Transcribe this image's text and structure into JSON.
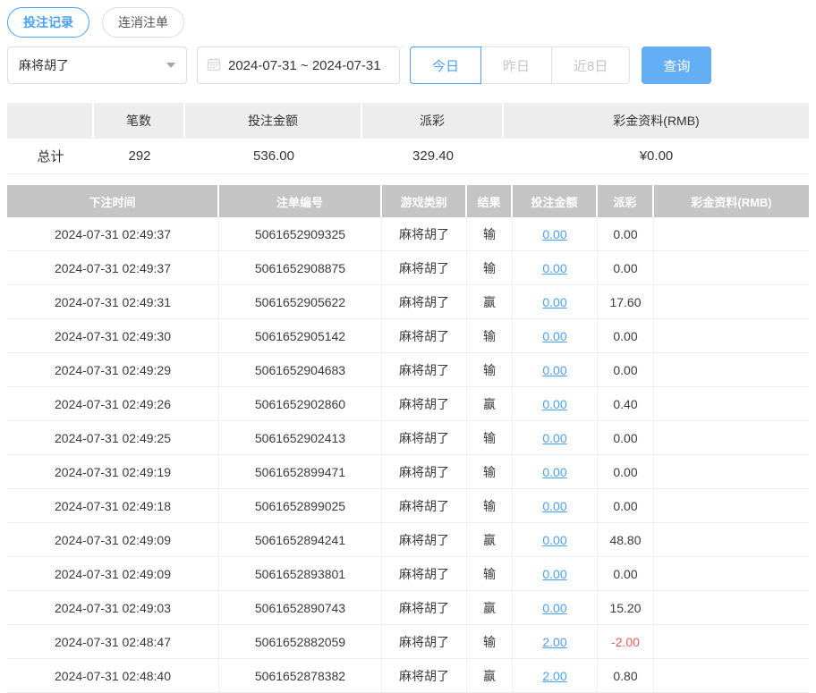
{
  "tabs": [
    {
      "label": "投注记录",
      "active": true
    },
    {
      "label": "连消注单",
      "active": false
    }
  ],
  "filters": {
    "game_select": "麻将胡了",
    "date_range": "2024-07-31 ~ 2024-07-31",
    "quick_buttons": [
      {
        "label": "今日",
        "active": true
      },
      {
        "label": "昨日",
        "active": false
      },
      {
        "label": "近8日",
        "active": false
      }
    ],
    "query_label": "查询"
  },
  "summary": {
    "headers": [
      "",
      "笔数",
      "投注金额",
      "派彩",
      "彩金资料(RMB)"
    ],
    "row": {
      "label": "总计",
      "count": "292",
      "bet_amount": "536.00",
      "payout": "329.40",
      "bonus": "¥0.00"
    }
  },
  "table": {
    "headers": [
      "下注时间",
      "注单编号",
      "游戏类别",
      "结果",
      "投注金额",
      "派彩",
      "彩金资料(RMB)"
    ],
    "records": [
      {
        "time": "2024-07-31 02:49:37",
        "bet_id": "5061652909325",
        "game": "麻将胡了",
        "result": "输",
        "amount": "0.00",
        "payout": "0.00",
        "bonus": ""
      },
      {
        "time": "2024-07-31 02:49:37",
        "bet_id": "5061652908875",
        "game": "麻将胡了",
        "result": "输",
        "amount": "0.00",
        "payout": "0.00",
        "bonus": ""
      },
      {
        "time": "2024-07-31 02:49:31",
        "bet_id": "5061652905622",
        "game": "麻将胡了",
        "result": "赢",
        "amount": "0.00",
        "payout": "17.60",
        "bonus": ""
      },
      {
        "time": "2024-07-31 02:49:30",
        "bet_id": "5061652905142",
        "game": "麻将胡了",
        "result": "输",
        "amount": "0.00",
        "payout": "0.00",
        "bonus": ""
      },
      {
        "time": "2024-07-31 02:49:29",
        "bet_id": "5061652904683",
        "game": "麻将胡了",
        "result": "输",
        "amount": "0.00",
        "payout": "0.00",
        "bonus": ""
      },
      {
        "time": "2024-07-31 02:49:26",
        "bet_id": "5061652902860",
        "game": "麻将胡了",
        "result": "赢",
        "amount": "0.00",
        "payout": "0.40",
        "bonus": ""
      },
      {
        "time": "2024-07-31 02:49:25",
        "bet_id": "5061652902413",
        "game": "麻将胡了",
        "result": "输",
        "amount": "0.00",
        "payout": "0.00",
        "bonus": ""
      },
      {
        "time": "2024-07-31 02:49:19",
        "bet_id": "5061652899471",
        "game": "麻将胡了",
        "result": "输",
        "amount": "0.00",
        "payout": "0.00",
        "bonus": ""
      },
      {
        "time": "2024-07-31 02:49:18",
        "bet_id": "5061652899025",
        "game": "麻将胡了",
        "result": "输",
        "amount": "0.00",
        "payout": "0.00",
        "bonus": ""
      },
      {
        "time": "2024-07-31 02:49:09",
        "bet_id": "5061652894241",
        "game": "麻将胡了",
        "result": "赢",
        "amount": "0.00",
        "payout": "48.80",
        "bonus": ""
      },
      {
        "time": "2024-07-31 02:49:09",
        "bet_id": "5061652893801",
        "game": "麻将胡了",
        "result": "输",
        "amount": "0.00",
        "payout": "0.00",
        "bonus": ""
      },
      {
        "time": "2024-07-31 02:49:03",
        "bet_id": "5061652890743",
        "game": "麻将胡了",
        "result": "赢",
        "amount": "0.00",
        "payout": "15.20",
        "bonus": ""
      },
      {
        "time": "2024-07-31 02:48:47",
        "bet_id": "5061652882059",
        "game": "麻将胡了",
        "result": "输",
        "amount": "2.00",
        "payout": "-2.00",
        "bonus": ""
      },
      {
        "time": "2024-07-31 02:48:40",
        "bet_id": "5061652878382",
        "game": "麻将胡了",
        "result": "赢",
        "amount": "2.00",
        "payout": "0.80",
        "bonus": ""
      }
    ]
  },
  "colors": {
    "accent_blue": "#4aa0f5",
    "query_button_bg": "#63aef5",
    "negative_red": "#f05a5a",
    "table_header_bg": "#c4c4c4",
    "summary_header_bg": "#ededed"
  }
}
